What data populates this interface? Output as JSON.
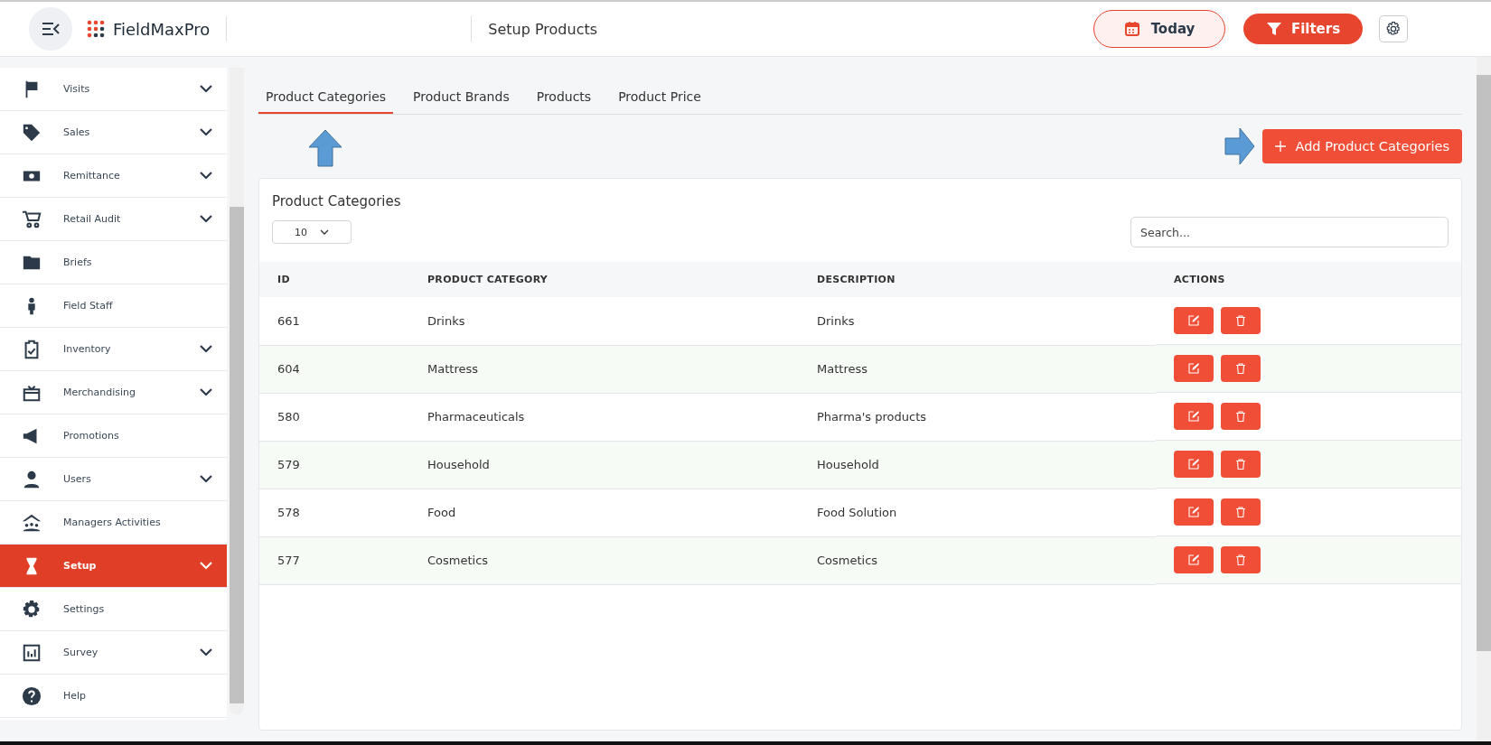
{
  "header": {
    "brand": "FieldMaxPro",
    "page_title": "Setup Products",
    "today_button": "Today",
    "filters_button": "Filters"
  },
  "sidebar": {
    "items": [
      {
        "label": "Visits",
        "selected": false,
        "has_submenu": true
      },
      {
        "label": "Sales",
        "selected": false,
        "has_submenu": true
      },
      {
        "label": "Remittance",
        "selected": false,
        "has_submenu": true
      },
      {
        "label": "Retail Audit",
        "selected": false,
        "has_submenu": true
      },
      {
        "label": "Briefs",
        "selected": false,
        "has_submenu": false
      },
      {
        "label": "Field Staff",
        "selected": false,
        "has_submenu": false
      },
      {
        "label": "Inventory",
        "selected": false,
        "has_submenu": true
      },
      {
        "label": "Merchandising",
        "selected": false,
        "has_submenu": true
      },
      {
        "label": "Promotions",
        "selected": false,
        "has_submenu": false
      },
      {
        "label": "Users",
        "selected": false,
        "has_submenu": true
      },
      {
        "label": "Managers Activities",
        "selected": false,
        "has_submenu": false
      },
      {
        "label": "Setup",
        "selected": true,
        "has_submenu": true
      },
      {
        "label": "Settings",
        "selected": false,
        "has_submenu": false
      },
      {
        "label": "Survey",
        "selected": false,
        "has_submenu": true
      },
      {
        "label": "Help",
        "selected": false,
        "has_submenu": false
      }
    ]
  },
  "tabs": [
    {
      "label": "Product Categories",
      "selected": true
    },
    {
      "label": "Product Brands",
      "selected": false
    },
    {
      "label": "Products",
      "selected": false
    },
    {
      "label": "Product Price",
      "selected": false
    }
  ],
  "add_button": "Add Product Categories",
  "card": {
    "title": "Product Categories",
    "page_size": "10",
    "search": {
      "placeholder": "Search..."
    },
    "table": {
      "columns": [
        "ID",
        "PRODUCT CATEGORY",
        "DESCRIPTION",
        "ACTIONS"
      ],
      "rows": [
        {
          "id": "661",
          "category": "Drinks",
          "description": "Drinks"
        },
        {
          "id": "604",
          "category": "Mattress",
          "description": "Mattress"
        },
        {
          "id": "580",
          "category": "Pharmaceuticals",
          "description": "Pharma's products"
        },
        {
          "id": "579",
          "category": "Household",
          "description": "Household"
        },
        {
          "id": "578",
          "category": "Food",
          "description": "Food Solution"
        },
        {
          "id": "577",
          "category": "Cosmetics",
          "description": "Cosmetics"
        }
      ]
    }
  }
}
